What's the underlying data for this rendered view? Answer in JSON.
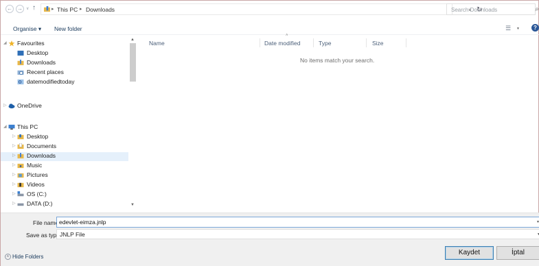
{
  "address_bar": {
    "crumbs": [
      "This PC",
      "Downloads"
    ],
    "search_placeholder": "Search Downloads"
  },
  "command_bar": {
    "organise_label": "Organise ▾",
    "new_folder_label": "New folder"
  },
  "nav_pane": {
    "items": [
      {
        "label": "Favourites",
        "icon": "star-icon"
      },
      {
        "label": "Desktop",
        "icon": "desktop-folder-icon"
      },
      {
        "label": "Downloads",
        "icon": "downloads-folder-icon"
      },
      {
        "label": "Recent places",
        "icon": "recent-places-icon"
      },
      {
        "label": "datemodifiedtoday",
        "icon": "saved-search-icon"
      },
      {
        "label": "OneDrive",
        "icon": "onedrive-icon"
      },
      {
        "label": "This PC",
        "icon": "computer-icon"
      },
      {
        "label": "Desktop",
        "icon": "desktop-folder-icon"
      },
      {
        "label": "Documents",
        "icon": "documents-folder-icon"
      },
      {
        "label": "Downloads",
        "icon": "downloads-folder-icon",
        "selected": true
      },
      {
        "label": "Music",
        "icon": "music-folder-icon"
      },
      {
        "label": "Pictures",
        "icon": "pictures-folder-icon"
      },
      {
        "label": "Videos",
        "icon": "videos-folder-icon"
      },
      {
        "label": "OS (C:)",
        "icon": "drive-icon"
      },
      {
        "label": "DATA (D:)",
        "icon": "drive-icon"
      }
    ]
  },
  "file_list": {
    "columns": [
      "Name",
      "Date modified",
      "Type",
      "Size"
    ],
    "empty_message": "No items match your search."
  },
  "bottom": {
    "file_name_label": "File name:",
    "file_name_value": "edevlet-eimza.jnlp",
    "save_as_type_label": "Save as type:",
    "save_as_type_value": "JNLP File",
    "hide_folders_label": "Hide Folders",
    "save_button": "Kaydet",
    "cancel_button": "İptal"
  },
  "colors": {
    "accent": "#2b5797",
    "selection": "#e5f0fb"
  }
}
